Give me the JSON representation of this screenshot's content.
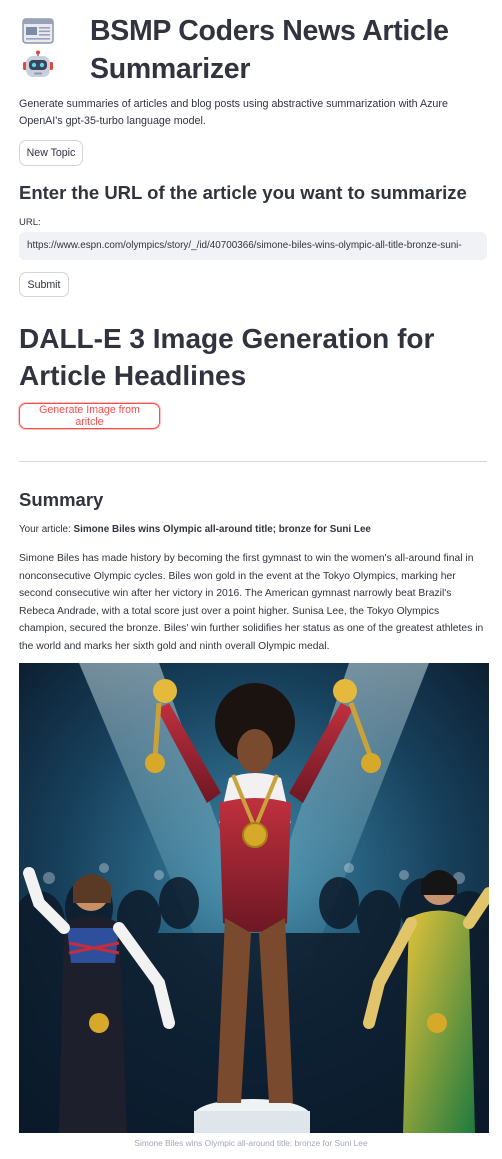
{
  "header": {
    "title": "BSMP Coders News Article Summarizer",
    "description": "Generate summaries of articles and blog posts using abstractive summarization with Azure OpenAI's gpt-35-turbo language model.",
    "icons": [
      "newspaper-icon",
      "robot-icon"
    ]
  },
  "buttons": {
    "new_topic": "New Topic",
    "submit": "Submit",
    "generate_image": "Generate Image from aritcle"
  },
  "url_section": {
    "heading": "Enter the URL of the article you want to summarize",
    "label": "URL:",
    "value": "https://www.espn.com/olympics/story/_/id/40700366/simone-biles-wins-olympic-all-title-bronze-suni-"
  },
  "dalle_section": {
    "heading": "DALL-E 3 Image Generation for Article Headlines"
  },
  "summary": {
    "heading": "Summary",
    "article_label": "Your article:",
    "article_title": "Simone Biles wins Olympic all-around title; bronze for Suni Lee",
    "text": "Simone Biles has made history by becoming the first gymnast to win the women's all-around final in nonconsecutive Olympic cycles. Biles won gold in the event at the Tokyo Olympics, marking her second consecutive win after her victory in 2016. The American gymnast narrowly beat Brazil's Rebeca Andrade, with a total score just over a point higher. Sunisa Lee, the Tokyo Olympics champion, secured the bronze. Biles' win further solidifies her status as one of the greatest athletes in the world and marks her sixth gold and ninth overall Olympic medal.",
    "image_caption": "Simone Biles wins Olympic all-around title; bronze for Suni Lee"
  },
  "colors": {
    "primary": "#ff4b4b",
    "text": "#31333f",
    "input_bg": "#f0f2f6",
    "caption": "#a3a8b4"
  }
}
